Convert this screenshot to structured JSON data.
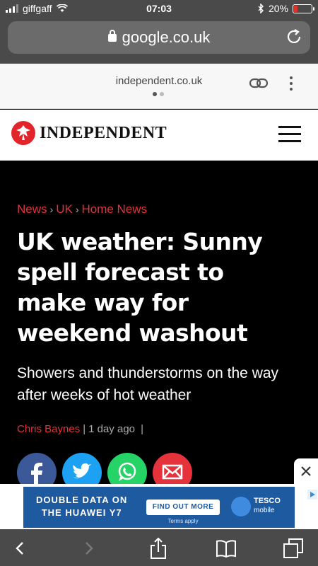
{
  "status_bar": {
    "carrier": "giffgaff",
    "time": "07:03",
    "battery": "20%"
  },
  "url_bar": {
    "host": "google.co.uk"
  },
  "amp_header": {
    "domain": "independent.co.uk"
  },
  "site": {
    "logo_text": "INDEPENDENT"
  },
  "article": {
    "breadcrumbs": [
      "News",
      "UK",
      "Home News"
    ],
    "headline": "UK weather: Sunny spell forecast to make way for weekend washout",
    "standfirst": "Showers and thunderstorms on the way after weeks of hot weather",
    "author": "Chris Baynes",
    "time": "1 day ago"
  },
  "ad": {
    "copy_line1": "DOUBLE DATA ON",
    "copy_line2": "THE HUAWEI Y7",
    "cta": "FIND OUT MORE",
    "terms": "Terms apply",
    "brand": "TESCO",
    "brand_sub": "mobile"
  },
  "icons": {
    "share": [
      "facebook-icon",
      "twitter-icon",
      "whatsapp-icon",
      "email-icon"
    ],
    "toolbar": [
      "back-icon",
      "forward-icon",
      "share-icon",
      "bookmarks-icon",
      "tabs-icon"
    ]
  },
  "colors": {
    "accent_red": "#e5323b",
    "facebook": "#3b5998",
    "twitter": "#1da1f2",
    "whatsapp": "#25d366",
    "ad_blue": "#1e5aa0"
  }
}
